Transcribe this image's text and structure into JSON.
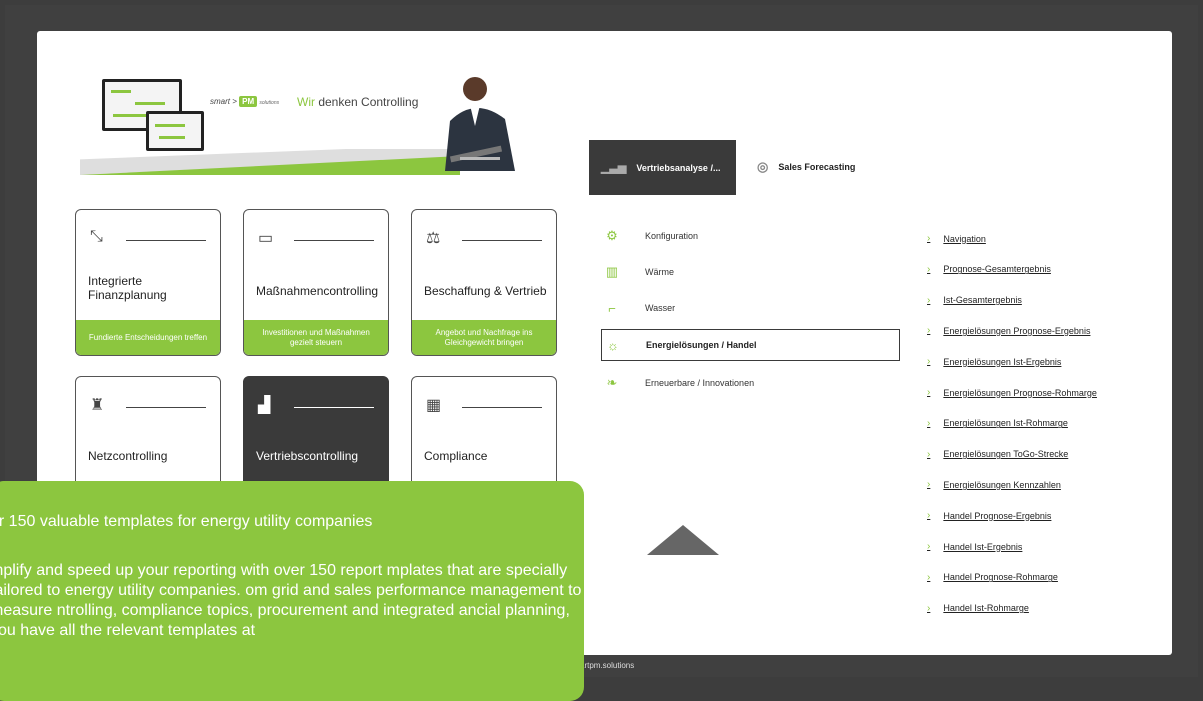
{
  "banner": {
    "logo_prefix": "smart",
    "logo_pm": "PM",
    "logo_suffix": "solutions",
    "tagline_first": "Wir",
    "tagline_rest": " denken Controlling"
  },
  "tiles": [
    {
      "icon": "compress-arrows-icon",
      "title": "Integrierte Finanzplanung",
      "footer": "Fundierte Entscheidungen treffen"
    },
    {
      "icon": "gantt-icon",
      "title": "Maßnahmencontrolling",
      "footer": "Investitionen und Maßnahmen gezielt steuern"
    },
    {
      "icon": "scales-icon",
      "title": "Beschaffung & Vertrieb",
      "footer": "Angebot und Nachfrage ins Gleichgewicht bringen"
    },
    {
      "icon": "power-pylon-icon",
      "title": "Netzcontrolling",
      "footer": ""
    },
    {
      "icon": "bar-chart-icon",
      "title": "Vertriebscontrolling",
      "footer": ""
    },
    {
      "icon": "checklist-grid-icon",
      "title": "Compliance",
      "footer": ""
    }
  ],
  "tabs": {
    "active": "Vertriebsanalyse /...",
    "second": "Sales Forecasting"
  },
  "menu": [
    {
      "icon": "gears-icon",
      "label": "Konfiguration"
    },
    {
      "icon": "radiator-icon",
      "label": "Wärme"
    },
    {
      "icon": "faucet-icon",
      "label": "Wasser"
    },
    {
      "icon": "bulb-icon",
      "label": "Energielösungen / Handel"
    },
    {
      "icon": "leaf-icon",
      "label": "Erneuerbare / Innovationen"
    }
  ],
  "links": [
    "Navigation",
    "Prognose-Gesamtergebnis",
    "Ist-Gesamtergebnis",
    "Energielösungen Prognose-Ergebnis",
    "Energielösungen Ist-Ergebnis",
    "Energielösungen Prognose-Rohmarge",
    "Energielösungen Ist-Rohmarge",
    "Energielösungen ToGo-Strecke",
    "Energielösungen Kennzahlen",
    "Handel Prognose-Ergebnis",
    "Handel Ist-Ergebnis",
    "Handel Prognose-Rohmarge",
    "Handel Ist-Rohmarge"
  ],
  "footer_url": "artpm.solutions",
  "overlay": {
    "heading": "er 150 valuable templates for energy utility companies",
    "body": "mplify and speed up your reporting with over 150 report mplates that are specially tailored to energy utility companies. om grid and sales performance management to measure ntrolling, compliance topics, procurement and integrated ancial planning, you have all the relevant templates at"
  },
  "colors": {
    "accent": "#8cc63f",
    "dark": "#3a3a3a",
    "frame": "#404040"
  }
}
